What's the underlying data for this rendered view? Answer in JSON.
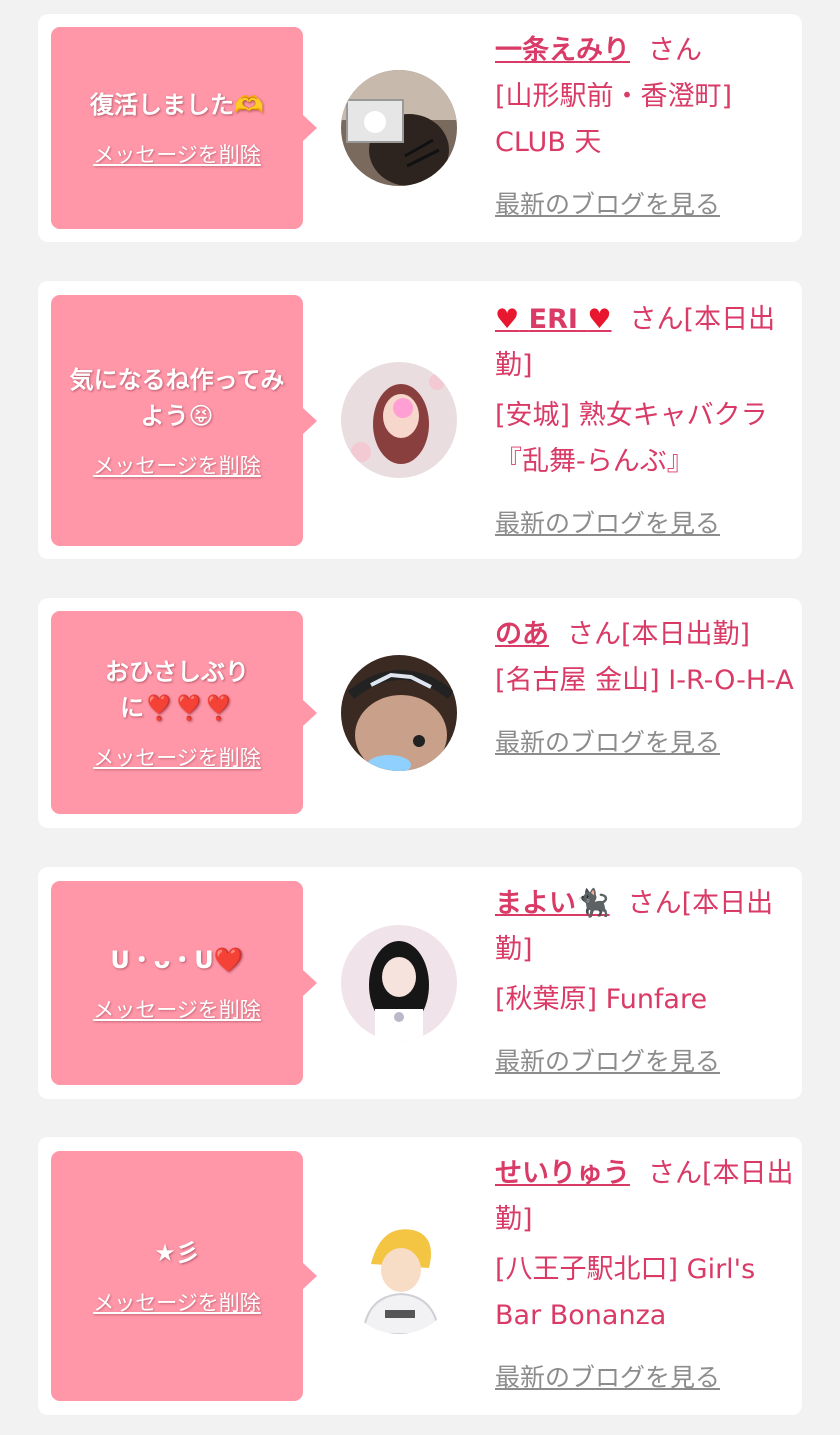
{
  "items": [
    {
      "message": "復活しました🫶",
      "delete_label": "メッセージを削除",
      "name": "一条えみり",
      "suffix": "さん",
      "shop": "[山形駅前・香澄町] CLUB 天",
      "blog_label": "最新のブログを見る"
    },
    {
      "message": "気になるね作ってみよう😝",
      "delete_label": "メッセージを削除",
      "name_prefix": "♥",
      "name": "ERI",
      "name_suffix": "♥",
      "suffix": "さん[本日出勤]",
      "shop": "[安城] 熟女キャバクラ『乱舞-らんぶ』",
      "blog_label": "最新のブログを見る"
    },
    {
      "message": "おひさしぶりに❣️❣️❣️",
      "delete_label": "メッセージを削除",
      "name": "のあ",
      "suffix": "さん[本日出勤]",
      "shop": "[名古屋 金山] I-R-O-H-A",
      "blog_label": "最新のブログを見る"
    },
    {
      "message": "U・ᴗ・U❤️",
      "delete_label": "メッセージを削除",
      "name": "まよい🐈‍⬛",
      "suffix": "さん[本日出勤]",
      "shop": "[秋葉原] Funfare",
      "blog_label": "最新のブログを見る"
    },
    {
      "message": "★彡",
      "delete_label": "メッセージを削除",
      "name": "せいりゅう",
      "suffix": "さん[本日出勤]",
      "shop": "[八王子駅北口] Girl's Bar Bonanza",
      "blog_label": "最新のブログを見る"
    }
  ],
  "colors": {
    "bubble": "#ff97a8",
    "accent": "#d93a66",
    "link_gray": "#8c8c8c",
    "background": "#f2f2f2"
  }
}
